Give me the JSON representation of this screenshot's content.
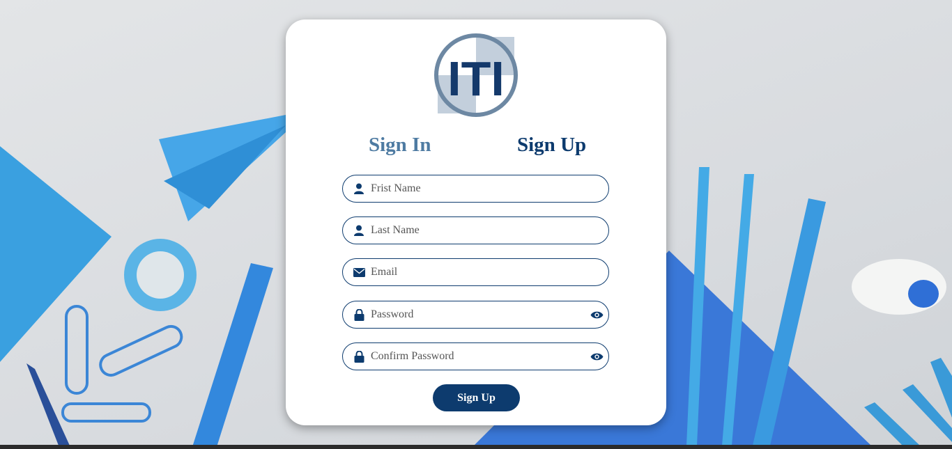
{
  "logo": {
    "text": "ITI"
  },
  "tabs": [
    {
      "label": "Sign In",
      "active": false
    },
    {
      "label": "Sign Up",
      "active": true
    }
  ],
  "form": {
    "first_name": {
      "placeholder": "Frist Name",
      "icon": "user-icon"
    },
    "last_name": {
      "placeholder": "Last Name",
      "icon": "user-icon"
    },
    "email": {
      "placeholder": "Email",
      "icon": "envelope-icon"
    },
    "password": {
      "placeholder": "Password",
      "icon": "lock-icon",
      "toggle_icon": "eye-icon"
    },
    "confirm_password": {
      "placeholder": "Confirm Password",
      "icon": "lock-icon",
      "toggle_icon": "eye-icon"
    },
    "submit_label": "Sign Up"
  },
  "colors": {
    "primary": "#0d3b6e",
    "inactive_tab": "#4e7ba2",
    "logo_ring": "#6d88a3",
    "logo_tint": "#c3cfdc"
  }
}
